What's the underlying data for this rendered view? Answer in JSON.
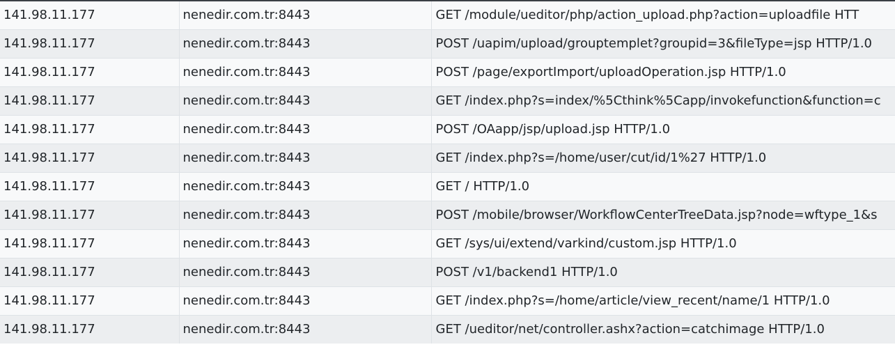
{
  "rows": [
    {
      "ip": "141.98.11.177",
      "host": "nenedir.com.tr:8443",
      "request": "GET /module/ueditor/php/action_upload.php?action=uploadfile HTT"
    },
    {
      "ip": "141.98.11.177",
      "host": "nenedir.com.tr:8443",
      "request": "POST /uapim/upload/grouptemplet?groupid=3&fileType=jsp HTTP/1.0"
    },
    {
      "ip": "141.98.11.177",
      "host": "nenedir.com.tr:8443",
      "request": "POST /page/exportImport/uploadOperation.jsp HTTP/1.0"
    },
    {
      "ip": "141.98.11.177",
      "host": "nenedir.com.tr:8443",
      "request": "GET /index.php?s=index/%5Cthink%5Capp/invokefunction&function=c"
    },
    {
      "ip": "141.98.11.177",
      "host": "nenedir.com.tr:8443",
      "request": "POST /OAapp/jsp/upload.jsp HTTP/1.0"
    },
    {
      "ip": "141.98.11.177",
      "host": "nenedir.com.tr:8443",
      "request": "GET /index.php?s=/home/user/cut/id/1%27 HTTP/1.0"
    },
    {
      "ip": "141.98.11.177",
      "host": "nenedir.com.tr:8443",
      "request": "GET / HTTP/1.0"
    },
    {
      "ip": "141.98.11.177",
      "host": "nenedir.com.tr:8443",
      "request": "POST /mobile/browser/WorkflowCenterTreeData.jsp?node=wftype_1&s"
    },
    {
      "ip": "141.98.11.177",
      "host": "nenedir.com.tr:8443",
      "request": "GET /sys/ui/extend/varkind/custom.jsp HTTP/1.0"
    },
    {
      "ip": "141.98.11.177",
      "host": "nenedir.com.tr:8443",
      "request": "POST /v1/backend1 HTTP/1.0"
    },
    {
      "ip": "141.98.11.177",
      "host": "nenedir.com.tr:8443",
      "request": "GET /index.php?s=/home/article/view_recent/name/1 HTTP/1.0"
    },
    {
      "ip": "141.98.11.177",
      "host": "nenedir.com.tr:8443",
      "request": "GET /ueditor/net/controller.ashx?action=catchimage HTTP/1.0"
    }
  ]
}
